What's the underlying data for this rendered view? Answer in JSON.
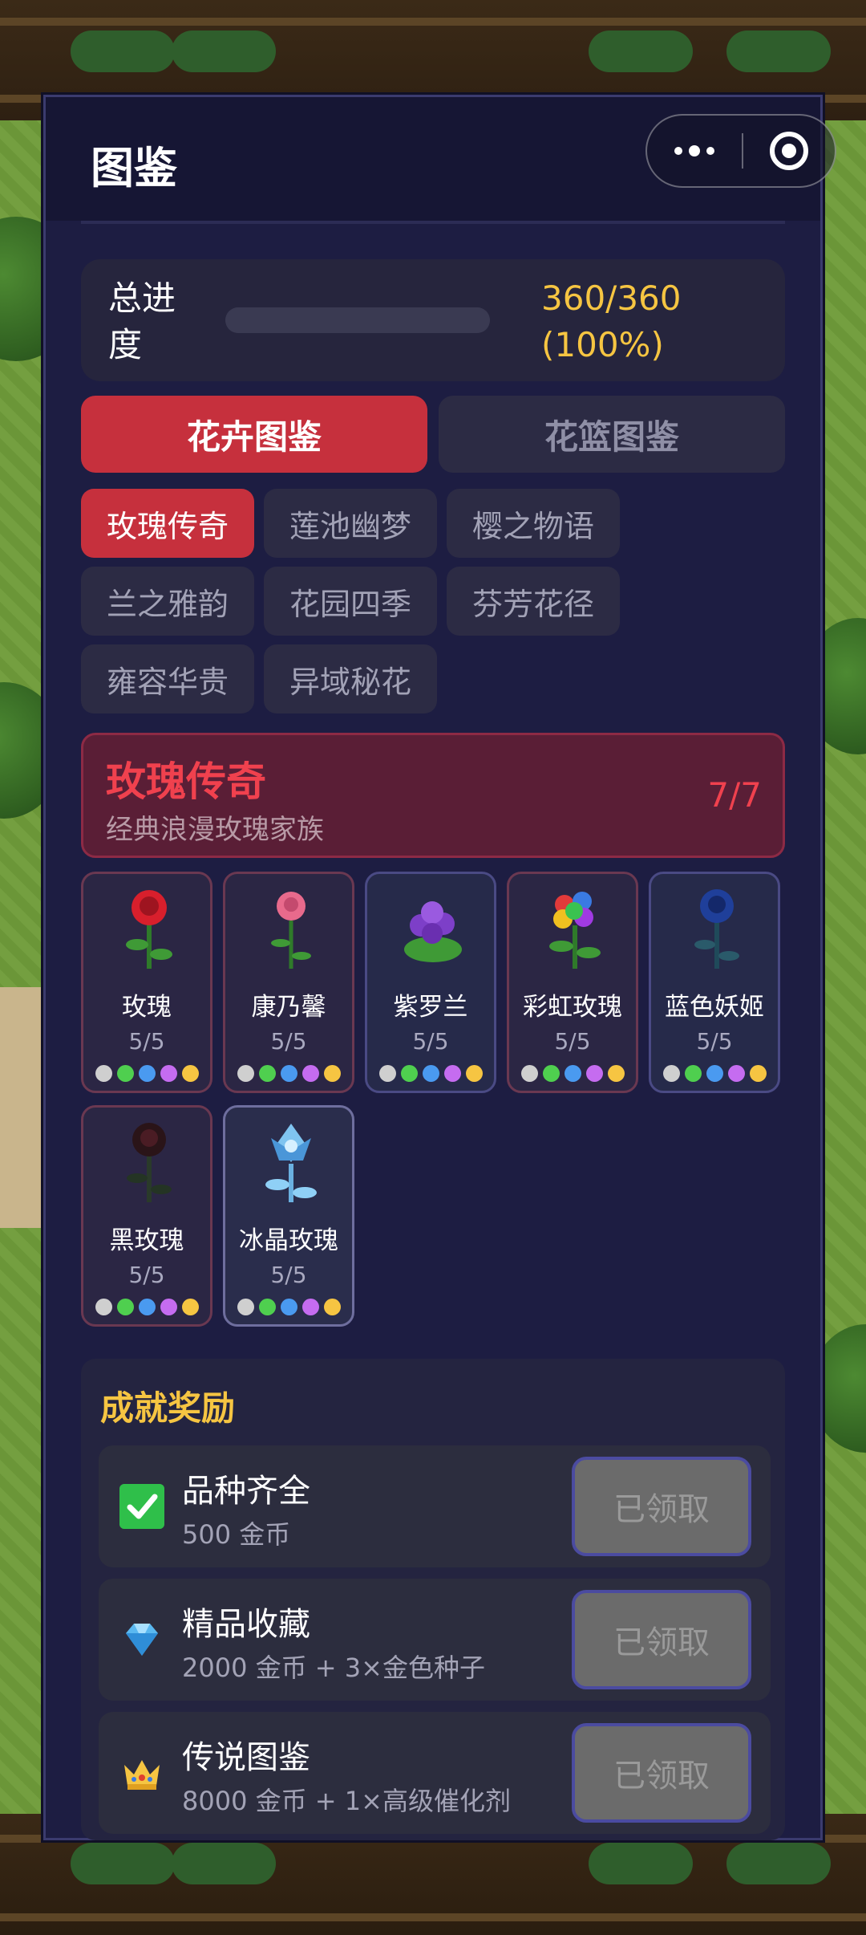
{
  "panel": {
    "title": "图鉴"
  },
  "progress": {
    "label": "总进度",
    "value_text": "360/360 (100%)",
    "current": 360,
    "total": 360,
    "percent": 100
  },
  "main_tabs": [
    {
      "label": "花卉图鉴",
      "active": true
    },
    {
      "label": "花篮图鉴",
      "active": false
    }
  ],
  "sub_tabs": [
    {
      "label": "玫瑰传奇",
      "active": true
    },
    {
      "label": "莲池幽梦",
      "active": false
    },
    {
      "label": "樱之物语",
      "active": false
    },
    {
      "label": "兰之雅韵",
      "active": false
    },
    {
      "label": "花园四季",
      "active": false
    },
    {
      "label": "芬芳花径",
      "active": false
    },
    {
      "label": "雍容华贵",
      "active": false
    },
    {
      "label": "异域秘花",
      "active": false
    }
  ],
  "series": {
    "name": "玫瑰传奇",
    "description": "经典浪漫玫瑰家族",
    "count": "7/7"
  },
  "flowers": [
    {
      "name": "玫瑰",
      "count": "5/5",
      "icon": "red-rose-icon",
      "color": "#d81f2c"
    },
    {
      "name": "康乃馨",
      "count": "5/5",
      "icon": "pink-carnation-icon",
      "color": "#e86a8c"
    },
    {
      "name": "紫罗兰",
      "count": "5/5",
      "icon": "violet-icon",
      "color": "#7d3fc8"
    },
    {
      "name": "彩虹玫瑰",
      "count": "5/5",
      "icon": "rainbow-rose-icon",
      "color": "#e8a020"
    },
    {
      "name": "蓝色妖姬",
      "count": "5/5",
      "icon": "blue-rose-icon",
      "color": "#1f3f9a"
    },
    {
      "name": "黑玫瑰",
      "count": "5/5",
      "icon": "black-rose-icon",
      "color": "#2a1418"
    },
    {
      "name": "冰晶玫瑰",
      "count": "5/5",
      "icon": "ice-rose-icon",
      "color": "#7fc4f0"
    }
  ],
  "quality_colors": [
    "#cfcfcf",
    "#4fcf4f",
    "#4a9af0",
    "#c56cf0",
    "#f6c542"
  ],
  "achievements": {
    "title": "成就奖励",
    "items": [
      {
        "name": "品种齐全",
        "reward": "500 金币",
        "button": "已领取",
        "icon": "checkmark-icon"
      },
      {
        "name": "精品收藏",
        "reward": "2000 金币 + 3×金色种子",
        "button": "已领取",
        "icon": "diamond-icon"
      },
      {
        "name": "传说图鉴",
        "reward": "8000 金币 + 1×高级催化剂",
        "button": "已领取",
        "icon": "crown-icon"
      }
    ]
  }
}
